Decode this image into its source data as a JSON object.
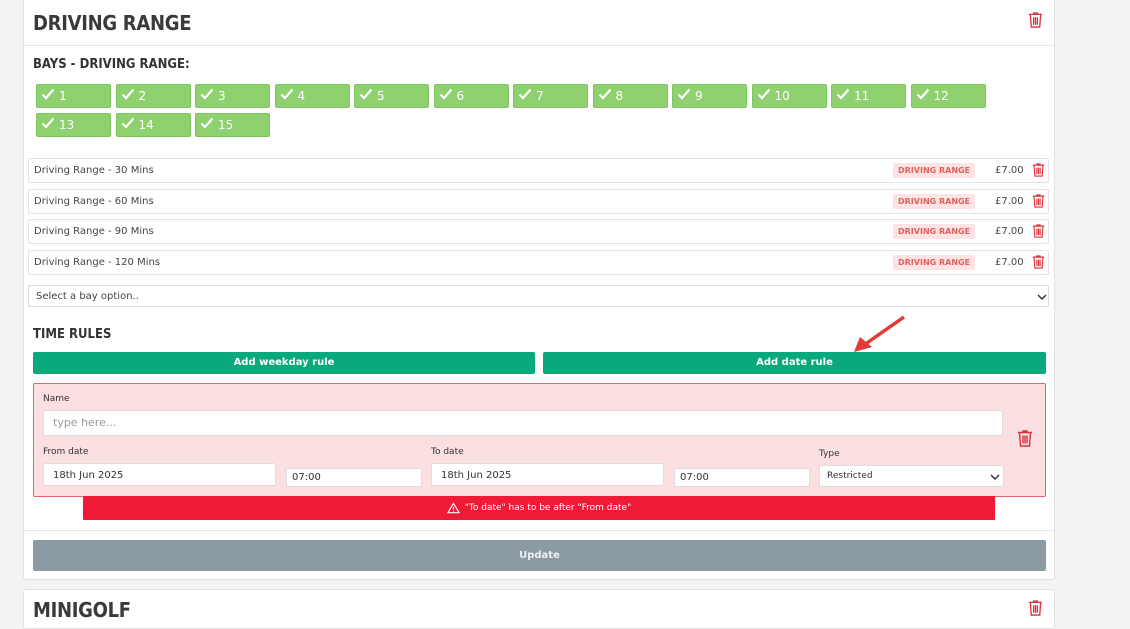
{
  "section": {
    "title": "DRIVING RANGE",
    "bays_label": "BAYS - DRIVING RANGE:",
    "bays": [
      "1",
      "2",
      "3",
      "4",
      "5",
      "6",
      "7",
      "8",
      "9",
      "10",
      "11",
      "12",
      "13",
      "14",
      "15"
    ],
    "options": [
      {
        "name": "Driving Range - 30 Mins",
        "badge": "DRIVING RANGE",
        "price": "£7.00"
      },
      {
        "name": "Driving Range - 60 Mins",
        "badge": "DRIVING RANGE",
        "price": "£7.00"
      },
      {
        "name": "Driving Range - 90 Mins",
        "badge": "DRIVING RANGE",
        "price": "£7.00"
      },
      {
        "name": "Driving Range - 120 Mins",
        "badge": "DRIVING RANGE",
        "price": "£7.00"
      }
    ],
    "bay_option_select": "Select a bay option.."
  },
  "time_rules": {
    "title": "TIME RULES",
    "add_weekday": "Add weekday rule",
    "add_date": "Add date rule",
    "rule": {
      "name_label": "Name",
      "name_placeholder": "type here...",
      "from_label": "From date",
      "from_date": "18th Jun 2025",
      "from_time": "07:00",
      "to_label": "To date",
      "to_date": "18th Jun 2025",
      "to_time": "07:00",
      "type_label": "Type",
      "type_value": "Restricted"
    },
    "error": "\"To date\" has to be after \"From date\""
  },
  "update_button": "Update",
  "next_section": {
    "title": "MINIGOLF"
  },
  "colors": {
    "bay_green": "#8fd16f",
    "action_green": "#0aa97c",
    "error_red": "#ef1a36",
    "trash_red": "#d8323c",
    "update_grey": "#8c9aa4"
  },
  "icons": [
    "trash-icon",
    "check-icon",
    "chevron-down-icon",
    "warning-icon",
    "arrow-annotation"
  ]
}
